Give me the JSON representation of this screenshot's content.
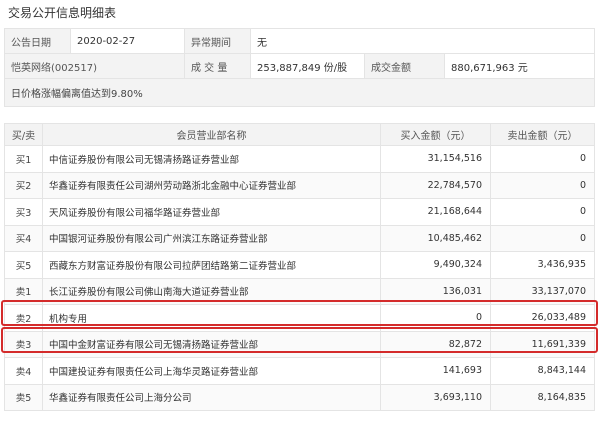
{
  "title": "交易公开信息明细表",
  "info": {
    "date_label": "公告日期",
    "date_value": "2020-02-27",
    "period_label": "异常期间",
    "period_value": "无",
    "stock": "恺英网络(002517)",
    "volume_label": "成 交 量",
    "volume_value": "253,887,849 份/股",
    "amount_label": "成交金额",
    "amount_value": "880,671,963 元",
    "reason": "日价格涨幅偏离值达到9.80%"
  },
  "table": {
    "headers": [
      "买/卖",
      "会员营业部名称",
      "买入金额（元）",
      "卖出金额（元）"
    ],
    "rows": [
      {
        "side": "买1",
        "name": "中信证券股份有限公司无锡清扬路证券营业部",
        "buy": "31,154,516",
        "sell": "0"
      },
      {
        "side": "买2",
        "name": "华鑫证券有限责任公司湖州劳动路浙北金融中心证券营业部",
        "buy": "22,784,570",
        "sell": "0"
      },
      {
        "side": "买3",
        "name": "天风证券股份有限公司福华路证券营业部",
        "buy": "21,168,644",
        "sell": "0"
      },
      {
        "side": "买4",
        "name": "中国银河证券股份有限公司广州滨江东路证券营业部",
        "buy": "10,485,462",
        "sell": "0"
      },
      {
        "side": "买5",
        "name": "西藏东方财富证券股份有限公司拉萨团结路第二证券营业部",
        "buy": "9,490,324",
        "sell": "3,436,935"
      },
      {
        "side": "卖1",
        "name": "长江证券股份有限公司佛山南海大道证券营业部",
        "buy": "136,031",
        "sell": "33,137,070"
      },
      {
        "side": "卖2",
        "name": "机构专用",
        "buy": "0",
        "sell": "26,033,489"
      },
      {
        "side": "卖3",
        "name": "中国中金财富证券有限公司无锡清扬路证券营业部",
        "buy": "82,872",
        "sell": "11,691,339"
      },
      {
        "side": "卖4",
        "name": "中国建投证券有限责任公司上海华灵路证券营业部",
        "buy": "141,693",
        "sell": "8,843,144"
      },
      {
        "side": "卖5",
        "name": "华鑫证券有限责任公司上海分公司",
        "buy": "3,693,110",
        "sell": "8,164,835"
      }
    ]
  },
  "highlight_color": "#d42b2b"
}
